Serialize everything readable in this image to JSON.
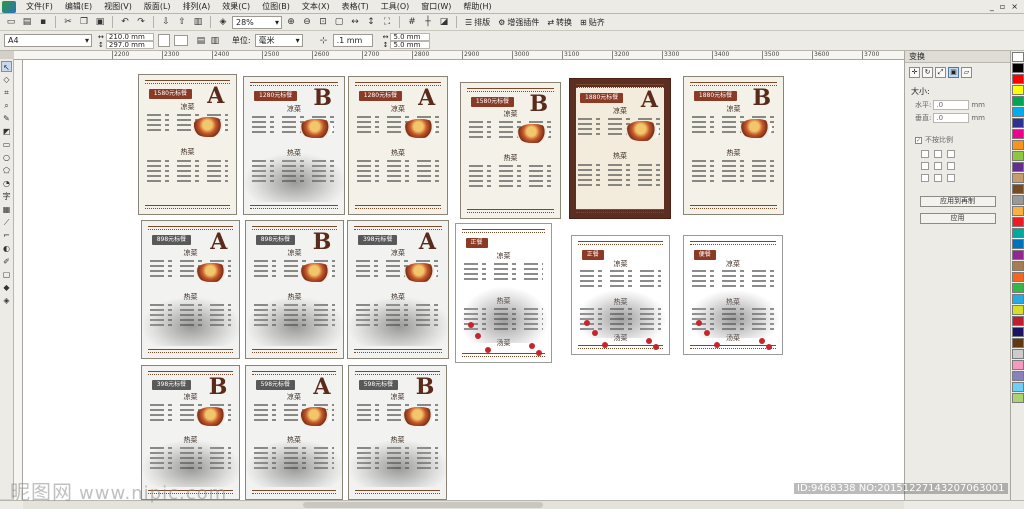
{
  "menubar": {
    "items": [
      "文件(F)",
      "编辑(E)",
      "视图(V)",
      "版面(L)",
      "排列(A)",
      "效果(C)",
      "位图(B)",
      "文本(X)",
      "表格(T)",
      "工具(O)",
      "窗口(W)",
      "帮助(H)"
    ]
  },
  "toolbar": {
    "zoom_value": "28%",
    "typeset_label": "排版",
    "plugin_label": "增强插件",
    "convert_label": "转换",
    "stick_label": "贴齐"
  },
  "property_bar": {
    "page_size": "A4",
    "width": "210.0 mm",
    "height": "297.0 mm",
    "unit_label": "单位:",
    "unit_value": "毫米",
    "nudge": ".1 mm",
    "dup_x": "5.0 mm",
    "dup_y": "5.0 mm"
  },
  "ruler": {
    "ticks": [
      "2200",
      "2300",
      "2400",
      "2500",
      "2600",
      "2700",
      "2800",
      "2900",
      "3000",
      "3100",
      "3200",
      "3300",
      "3400",
      "3500",
      "3600",
      "3700"
    ]
  },
  "cards": [
    {
      "price": "1580元标餐",
      "letter": "A",
      "style": "cream"
    },
    {
      "price": "1280元标餐",
      "letter": "B",
      "style": "ink"
    },
    {
      "price": "1280元标餐",
      "letter": "A",
      "style": "cream"
    },
    {
      "price": "1580元标餐",
      "letter": "B",
      "style": "cream"
    },
    {
      "price": "1880元标餐",
      "letter": "A",
      "style": "dark"
    },
    {
      "price": "1880元标餐",
      "letter": "B",
      "style": "cream"
    },
    {
      "price": "898元标餐",
      "letter": "A",
      "style": "gray"
    },
    {
      "price": "898元标餐",
      "letter": "B",
      "style": "gray"
    },
    {
      "price": "398元标餐",
      "letter": "A",
      "style": "gray"
    },
    {
      "price": "正餐",
      "letter": "",
      "style": "plain"
    },
    {
      "price": "正餐",
      "letter": "",
      "style": "plain"
    },
    {
      "price": "便餐",
      "letter": "",
      "style": "plain"
    },
    {
      "price": "398元标餐",
      "letter": "B",
      "style": "gray"
    },
    {
      "price": "598元标餐",
      "letter": "A",
      "style": "gray"
    },
    {
      "price": "598元标餐",
      "letter": "B",
      "style": "gray"
    }
  ],
  "section_labels": {
    "cold": "凉菜",
    "hot": "热菜",
    "soup": "汤菜"
  },
  "docker": {
    "title": "变换",
    "size_label": "大小:",
    "h_label": "水平:",
    "v_label": "垂直:",
    "h_value": ".0",
    "v_value": ".0",
    "unit": "mm",
    "nonprop_label": "不按比例",
    "apply_dup_label": "应用到再制",
    "apply_label": "应用"
  },
  "palette": [
    "#ffffff",
    "#000000",
    "#ff0000",
    "#ffff00",
    "#00a651",
    "#00aeef",
    "#2e3192",
    "#ec008c",
    "#f7941d",
    "#8dc63f",
    "#662d91",
    "#c69c6d",
    "#754c24",
    "#999999",
    "#fbb040",
    "#ed1c24",
    "#00a99d",
    "#0072bc",
    "#92278f",
    "#a67c52",
    "#f26522",
    "#39b54a",
    "#27aae1",
    "#d7df23",
    "#be1e2d",
    "#1b1464",
    "#603913",
    "#cccccc",
    "#f49ac1",
    "#8781bd",
    "#6dcff6",
    "#acd373"
  ],
  "watermark": {
    "brand": "昵图网",
    "url": "www.nipic.com",
    "image_id": "ID:9468338 NO:20151227143207063001"
  }
}
